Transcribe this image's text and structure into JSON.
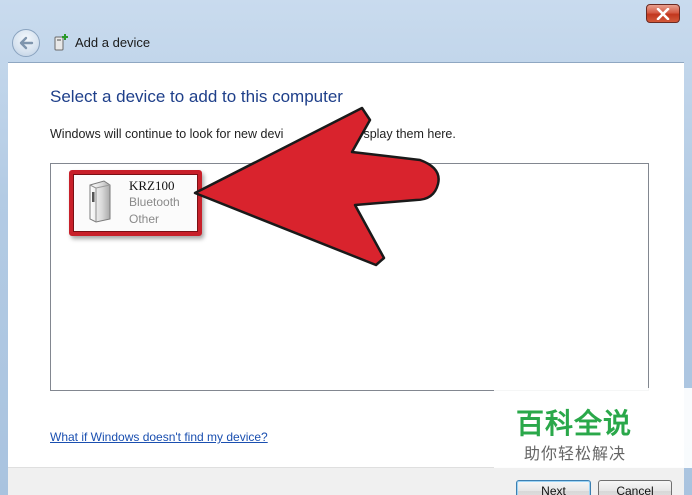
{
  "window": {
    "title": "Add a device",
    "close_icon": "close-icon",
    "back_icon": "back-arrow-icon"
  },
  "main": {
    "heading": "Select a device to add to this computer",
    "subtitle": "Windows will continue to look for new devi",
    "subtitle_end": "splay them here.",
    "devices": [
      {
        "name": "KRZ100",
        "type": "Bluetooth",
        "category": "Other",
        "icon": "device-tower-icon"
      }
    ],
    "help_link": "What if Windows doesn't find my device?"
  },
  "footer": {
    "next_label": "Next",
    "cancel_label": "Cancel"
  },
  "watermark": {
    "title": "百科全说",
    "subtitle": "助你轻松解决"
  },
  "colors": {
    "heading": "#1e3f8a",
    "link": "#1a4fb0",
    "annotation_red": "#d9232d",
    "watermark_green": "#2aa84a"
  }
}
